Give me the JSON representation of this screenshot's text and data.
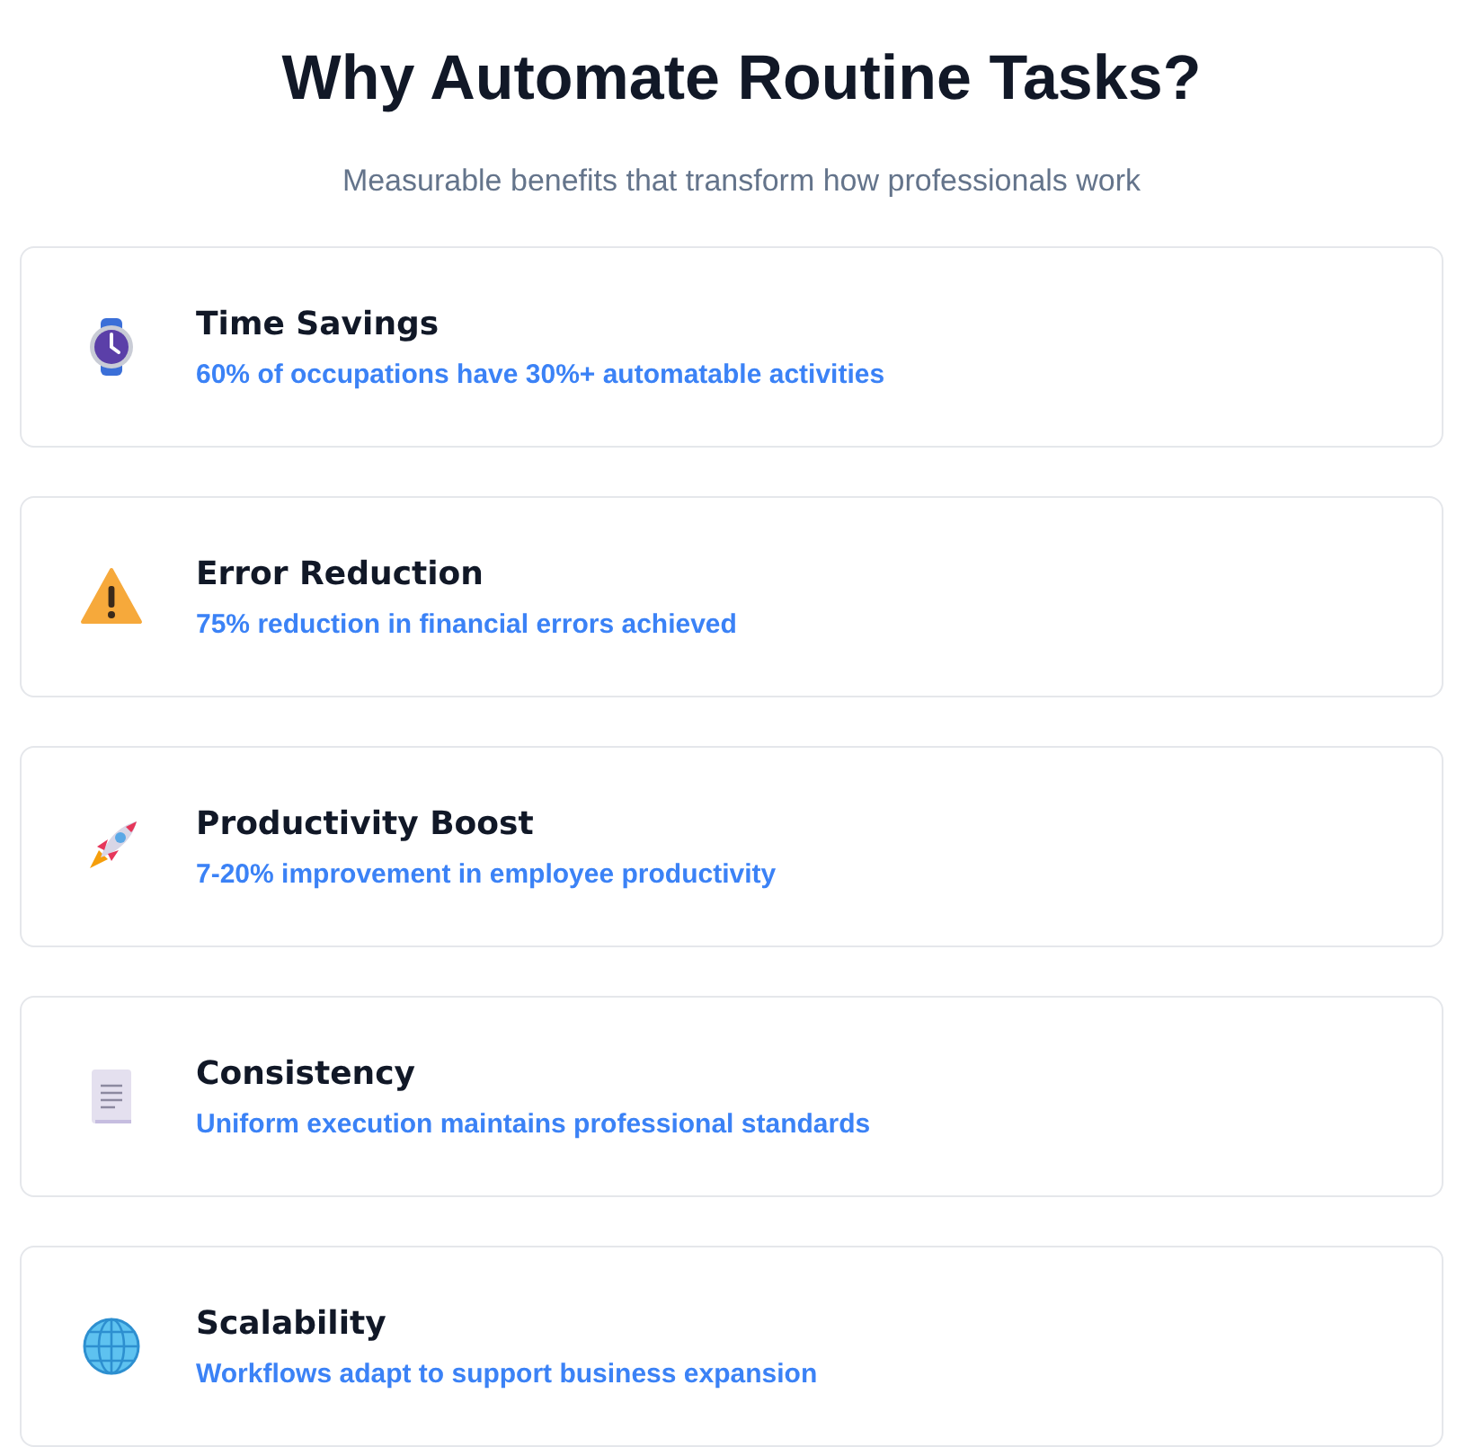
{
  "header": {
    "title": "Why Automate Routine Tasks?",
    "subtitle": "Measurable benefits that transform how professionals work"
  },
  "benefits": [
    {
      "title": "Time Savings",
      "description": "60% of occupations have 30%+ automatable activities"
    },
    {
      "title": "Error Reduction",
      "description": "75% reduction in financial errors achieved"
    },
    {
      "title": "Productivity Boost",
      "description": "7-20% improvement in employee productivity"
    },
    {
      "title": "Consistency",
      "description": "Uniform execution maintains professional standards"
    },
    {
      "title": "Scalability",
      "description": "Workflows adapt to support business expansion"
    }
  ]
}
